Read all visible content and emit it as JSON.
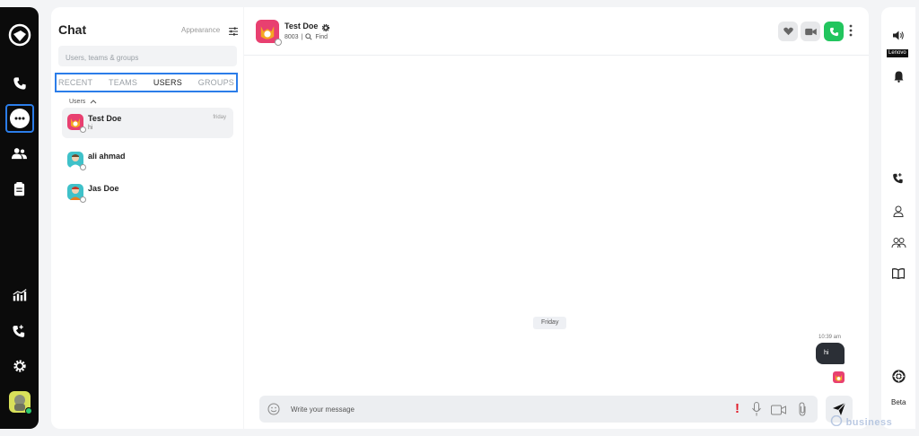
{
  "rail": {
    "items": [
      "logo",
      "phone",
      "chat",
      "contacts",
      "notes",
      "analytics",
      "call-transfer",
      "settings",
      "profile"
    ]
  },
  "list": {
    "title": "Chat",
    "appearance_label": "Appearance",
    "search_placeholder": "Users, teams & groups",
    "tabs": [
      "RECENT",
      "TEAMS",
      "USERS",
      "GROUPS"
    ],
    "active_tab": "USERS",
    "group_label": "Users",
    "contacts": [
      {
        "name": "Test Doe",
        "snippet": "hi",
        "time": "friday"
      },
      {
        "name": "ali ahmad",
        "snippet": "",
        "time": ""
      },
      {
        "name": "Jas Doe",
        "snippet": "",
        "time": ""
      }
    ]
  },
  "conversation": {
    "peer_name": "Test Doe",
    "peer_extension": "8003",
    "find_label": "Find",
    "day_separator": "Friday",
    "messages": [
      {
        "time": "10:39 am",
        "text": "hi",
        "direction": "outgoing"
      }
    ],
    "composer_placeholder": "Write your message",
    "warning_mark": "!"
  },
  "right_bar": {
    "device_label": "Lenovo",
    "beta_label": "Beta"
  },
  "watermark": "business",
  "colors": {
    "accent": "#2b7de9",
    "call_green": "#22c55e",
    "rail_bg": "#0b0b0b",
    "bubble_dark": "#2b2f36",
    "warning_red": "#e11d2a"
  }
}
